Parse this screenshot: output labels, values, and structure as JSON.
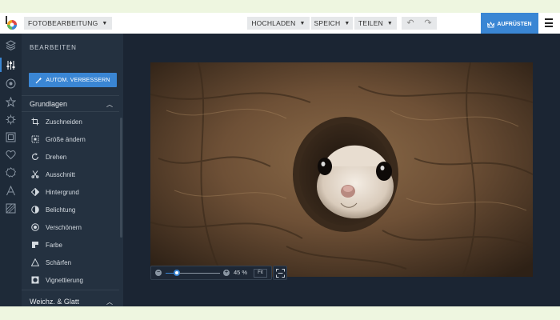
{
  "topbar": {
    "app_menu": "FOTOBEARBEITUNG",
    "upload": "HOCHLADEN",
    "save": "SPEICH",
    "share": "TEILEN",
    "upgrade": "AUFRÜSTEN"
  },
  "panel": {
    "title": "BEARBEITEN",
    "auto_enhance": "AUTOM. VERBESSERN",
    "sections": [
      {
        "label": "Grundlagen",
        "items": [
          {
            "label": "Zuschneiden",
            "icon": "crop-icon"
          },
          {
            "label": "Größe ändern",
            "icon": "resize-icon"
          },
          {
            "label": "Drehen",
            "icon": "rotate-icon"
          },
          {
            "label": "Ausschnitt",
            "icon": "cut-icon"
          },
          {
            "label": "Hintergrund",
            "icon": "background-icon"
          },
          {
            "label": "Belichtung",
            "icon": "exposure-icon"
          },
          {
            "label": "Verschönern",
            "icon": "beautify-icon"
          },
          {
            "label": "Farbe",
            "icon": "color-icon"
          },
          {
            "label": "Schärfen",
            "icon": "sharpen-icon"
          },
          {
            "label": "Vignettierung",
            "icon": "vignette-icon"
          }
        ]
      },
      {
        "label": "Weichz. & Glatt",
        "items": []
      }
    ]
  },
  "rail": [
    "layers-icon",
    "adjust-icon",
    "eye-icon",
    "star-icon",
    "gear-icon",
    "frame-icon",
    "heart-icon",
    "badge-icon",
    "text-icon",
    "texture-icon"
  ],
  "zoom": {
    "value_label": "45 %",
    "fit_label": "Fit",
    "level": 0.2
  },
  "colors": {
    "accent": "#3a86d4",
    "topbar_bg": "#ffffff",
    "panel_bg": "#243140",
    "canvas_bg": "#1b2533"
  }
}
